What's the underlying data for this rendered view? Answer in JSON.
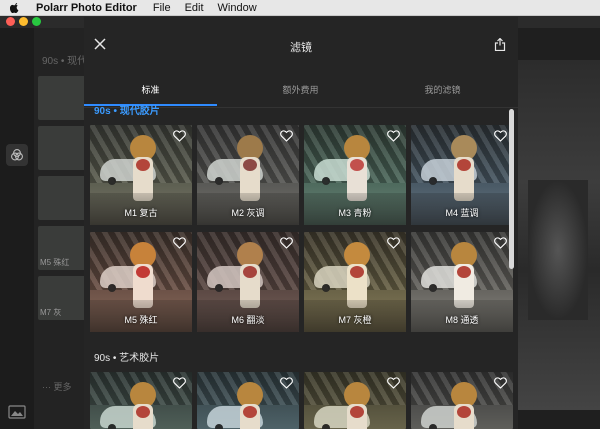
{
  "menubar": {
    "app": "Polarr Photo Editor",
    "items": [
      "File",
      "Edit",
      "Window"
    ]
  },
  "background": {
    "panel_title": "90s • 现代",
    "thumbs": [
      "",
      "",
      "",
      "M5 殊红",
      "M7 灰"
    ],
    "more": "··· 更多"
  },
  "modal": {
    "title": "滤镜",
    "tabs": [
      {
        "label": "标准",
        "active": true
      },
      {
        "label": "额外费用",
        "active": false
      },
      {
        "label": "我的滤镜",
        "active": false
      }
    ],
    "sections": [
      {
        "title": "90s • 现代胶片",
        "highlight": true,
        "filters": [
          "M1 复古",
          "M2 灰调",
          "M3 青粉",
          "M4 蓝调",
          "M5 殊红",
          "M6 翻淡",
          "M7 灰橙",
          "M8 通透"
        ]
      },
      {
        "title": "90s • 艺术胶片",
        "highlight": false,
        "filters": [
          "",
          "",
          "",
          ""
        ]
      }
    ]
  },
  "colors": {
    "accent": "#2f8bff",
    "section_highlight": "#3b9bff"
  }
}
